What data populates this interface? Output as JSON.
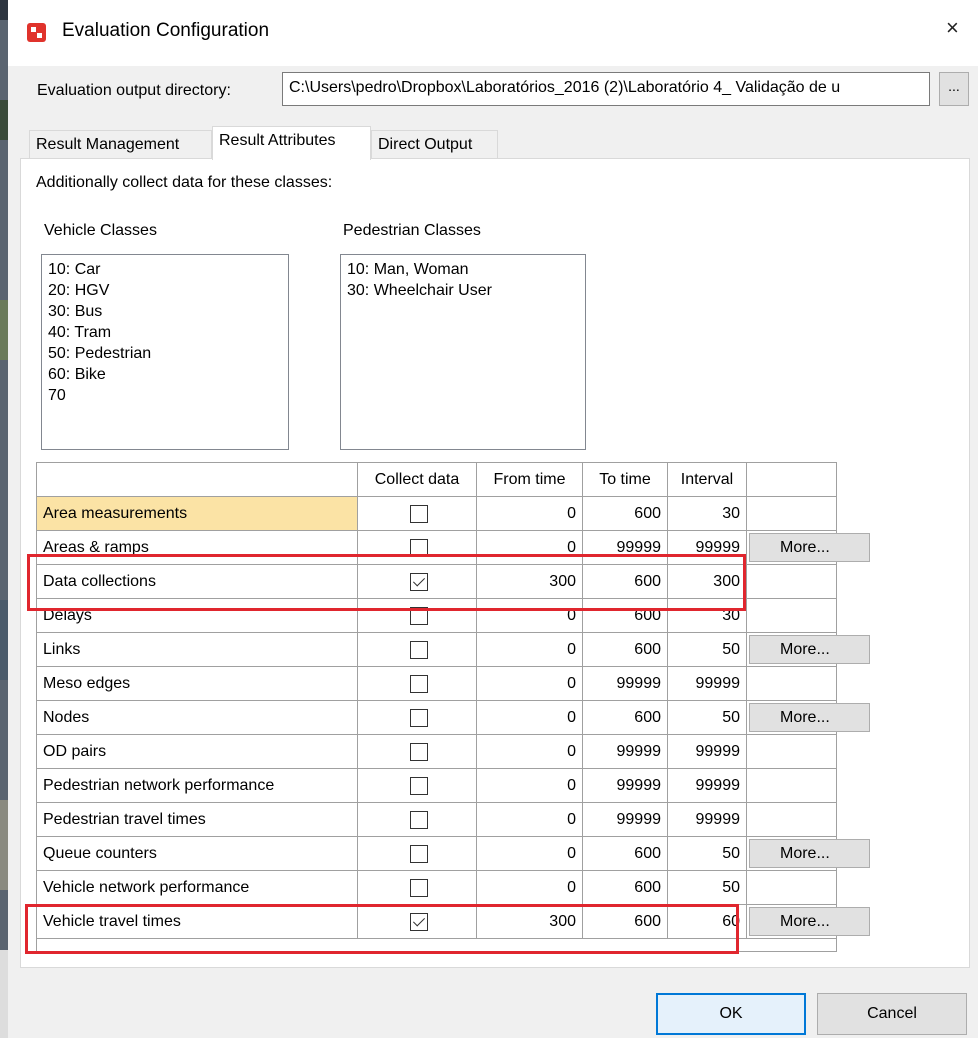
{
  "window": {
    "title": "Evaluation Configuration",
    "close_glyph": "×"
  },
  "output_dir": {
    "label": "Evaluation output directory:",
    "value": "C:\\Users\\pedro\\Dropbox\\Laboratórios_2016 (2)\\Laboratório 4_ Validação de u",
    "browse_label": "..."
  },
  "tabs": [
    {
      "label": "Result Management",
      "selected": false
    },
    {
      "label": "Result Attributes",
      "selected": true
    },
    {
      "label": "Direct Output",
      "selected": false
    }
  ],
  "panel": {
    "intro": "Additionally collect data for these classes:",
    "vehicle_classes": {
      "label": "Vehicle Classes",
      "items": [
        "10: Car",
        "20: HGV",
        "30: Bus",
        "40: Tram",
        "50: Pedestrian",
        "60: Bike",
        "70"
      ]
    },
    "pedestrian_classes": {
      "label": "Pedestrian Classes",
      "items": [
        "10: Man, Woman",
        "30: Wheelchair User"
      ]
    }
  },
  "table": {
    "headers": [
      "",
      "Collect data",
      "From time",
      "To time",
      "Interval",
      ""
    ],
    "more_label": "More...",
    "rows": [
      {
        "name": "Area measurements",
        "checked": false,
        "from": "0",
        "to": "600",
        "interval": "30",
        "more": false
      },
      {
        "name": "Areas & ramps",
        "checked": false,
        "from": "0",
        "to": "99999",
        "interval": "99999",
        "more": true
      },
      {
        "name": "Data collections",
        "checked": true,
        "from": "300",
        "to": "600",
        "interval": "300",
        "more": false
      },
      {
        "name": "Delays",
        "checked": false,
        "from": "0",
        "to": "600",
        "interval": "30",
        "more": false
      },
      {
        "name": "Links",
        "checked": false,
        "from": "0",
        "to": "600",
        "interval": "50",
        "more": true
      },
      {
        "name": "Meso edges",
        "checked": false,
        "from": "0",
        "to": "99999",
        "interval": "99999",
        "more": false
      },
      {
        "name": "Nodes",
        "checked": false,
        "from": "0",
        "to": "600",
        "interval": "50",
        "more": true
      },
      {
        "name": "OD pairs",
        "checked": false,
        "from": "0",
        "to": "99999",
        "interval": "99999",
        "more": false
      },
      {
        "name": "Pedestrian network performance",
        "checked": false,
        "from": "0",
        "to": "99999",
        "interval": "99999",
        "more": false
      },
      {
        "name": "Pedestrian travel times",
        "checked": false,
        "from": "0",
        "to": "99999",
        "interval": "99999",
        "more": false
      },
      {
        "name": "Queue counters",
        "checked": false,
        "from": "0",
        "to": "600",
        "interval": "50",
        "more": true
      },
      {
        "name": "Vehicle network performance",
        "checked": false,
        "from": "0",
        "to": "600",
        "interval": "50",
        "more": false
      },
      {
        "name": "Vehicle travel times",
        "checked": true,
        "from": "300",
        "to": "600",
        "interval": "60",
        "more": true
      }
    ]
  },
  "buttons": {
    "ok": "OK",
    "cancel": "Cancel"
  },
  "colors": {
    "highlight_box": "#e0262e",
    "selected_row_cell": "#fbe3a5",
    "default_button_border": "#0078d7"
  }
}
